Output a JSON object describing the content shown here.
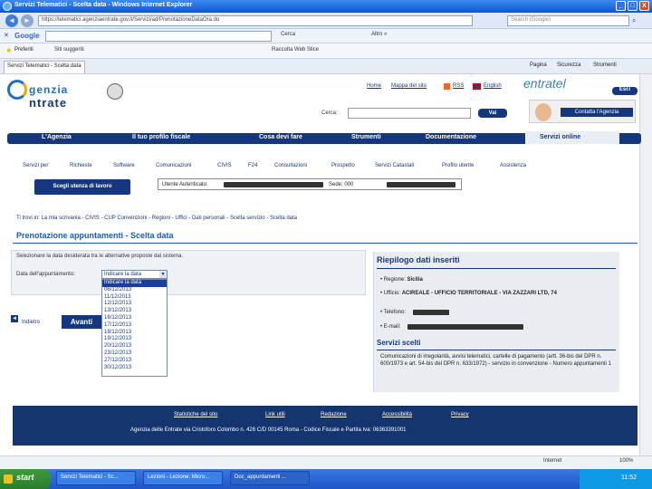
{
  "window": {
    "title": "Servizi Telematici - Scelta data - Windows Internet Explorer",
    "minimize": "_",
    "maximize": "□",
    "close": "X"
  },
  "browser": {
    "back": "◄",
    "forward": "►",
    "address": "https://telematici.agenziaentrate.gov.it/Servizi/ad/PrenotazioneDataOra.do",
    "search_placeholder": "Search (Google)",
    "google_label": "Google",
    "search_btn": "Cerca",
    "gbar_extra": "Altro »",
    "fav_label": "Preferiti",
    "fav_links": [
      "Siti suggeriti",
      "Raccolta Web Slice"
    ],
    "tab_label": "Servizi Telematici - Scelta data",
    "cmd": [
      "Pagina",
      "Sicurezza",
      "Strumenti"
    ]
  },
  "header": {
    "logo_top": "genzia",
    "logo_bottom": "ntrate",
    "links": [
      "Home",
      "Mappa del sito",
      "RSS",
      "English"
    ],
    "entratel": "entratel",
    "esci": "Esci",
    "cerca_label": "Cerca:",
    "vai": "Vai",
    "contatta": "Contatta l'Agenzia"
  },
  "menu": [
    "L'Agenzia",
    "Il tuo profilo fiscale",
    "Cosa devi fare",
    "Strumenti",
    "Documentazione",
    "Servizi online"
  ],
  "submenu": [
    "Servizi per",
    "Richieste",
    "Software",
    "Comunicazioni",
    "CIVIS",
    "F24",
    "Consultazioni",
    "Prospetto",
    "Servizi Catastali",
    "Profilo utente",
    "Assistenza"
  ],
  "scegli": "Scegli utenza di lavoro",
  "utente": {
    "label": "Utente Autenticato:",
    "sede_label": "Sede: 000"
  },
  "breadcrumb": "Ti trovi in: La mia scrivania - CIVIS - CUP Convenzioni - Regioni - Uffici - Dati personali - Scelta servizio - Scelta data",
  "page_title": "Prenotazione appuntamenti - Scelta data",
  "instruction": "Selezionare la data desiderata tra le alternative proposte dal sistema.",
  "data_label": "Data dell'appuntamento:",
  "select_value": "Indicare la data",
  "date_options": [
    "Indicare la data",
    "06/12/2013",
    "11/12/2013",
    "12/12/2013",
    "13/12/2013",
    "16/12/2013",
    "17/12/2013",
    "18/12/2013",
    "19/12/2013",
    "20/12/2013",
    "23/12/2013",
    "27/12/2013",
    "30/12/2013"
  ],
  "indietro": "Indietro",
  "avanti": "Avanti",
  "riepilogo": {
    "title": "Riepilogo dati inseriti",
    "regione_label": "Regione:",
    "regione": "Sicilia",
    "ufficio_label": "Ufficio:",
    "ufficio": "ACIREALE - UFFICIO TERRITORIALE - VIA ZAZZARI LTD, 74",
    "telefono_label": "Telefono:",
    "email_label": "E-mail:",
    "servizi_title": "Servizi scelti",
    "servizi_text": "Comunicazioni di irregolarità, avvisi telematici, cartelle di pagamento (artt. 36-bis del DPR n. 600/1973 e art. 54-bis del DPR n. 633/1972) - servizio in convenzione - Numero appuntamenti 1"
  },
  "footer": {
    "links": [
      "Statistiche del sito",
      "Link utili",
      "Redazione",
      "Accessibilità",
      "Privacy"
    ],
    "address": "Agenzia delle Entrate via Cristoforo Colombo n. 426 C/D 00145 Roma - Codice Fiscale e Partita Iva: 06363391001"
  },
  "status": {
    "zone": "Internet",
    "zoom": "100%"
  },
  "taskbar": {
    "start": "start",
    "tasks": [
      "Servizi Telematici - Sc...",
      "Lezioni - Lezione: Micro...",
      "Doc_appuntamenti ..."
    ],
    "clock": "11:52"
  }
}
